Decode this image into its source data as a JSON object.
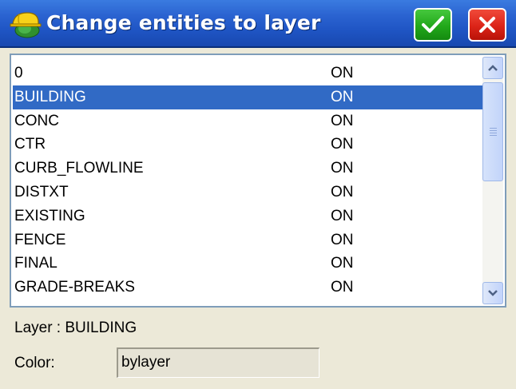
{
  "window": {
    "title": "Change entities to layer",
    "icon": "surveyor-hardhat-icon",
    "ok_icon": "checkmark-icon",
    "cancel_icon": "close-x-icon",
    "colors": {
      "titlebar": "#2a62d0",
      "ok": "#22a81a",
      "cancel": "#dc2418",
      "selection": "#316ac5"
    }
  },
  "layers": {
    "selected_index": 1,
    "rows": [
      {
        "name": "0",
        "status": "ON"
      },
      {
        "name": "BUILDING",
        "status": "ON"
      },
      {
        "name": "CONC",
        "status": "ON"
      },
      {
        "name": "CTR",
        "status": "ON"
      },
      {
        "name": "CURB_FLOWLINE",
        "status": "ON"
      },
      {
        "name": "DISTXT",
        "status": "ON"
      },
      {
        "name": "EXISTING",
        "status": "ON"
      },
      {
        "name": "FENCE",
        "status": "ON"
      },
      {
        "name": "FINAL",
        "status": "ON"
      },
      {
        "name": "GRADE-BREAKS",
        "status": "ON"
      }
    ]
  },
  "details": {
    "layer_label": "Layer : BUILDING",
    "color_label": "Color:",
    "color_value": "bylayer"
  }
}
